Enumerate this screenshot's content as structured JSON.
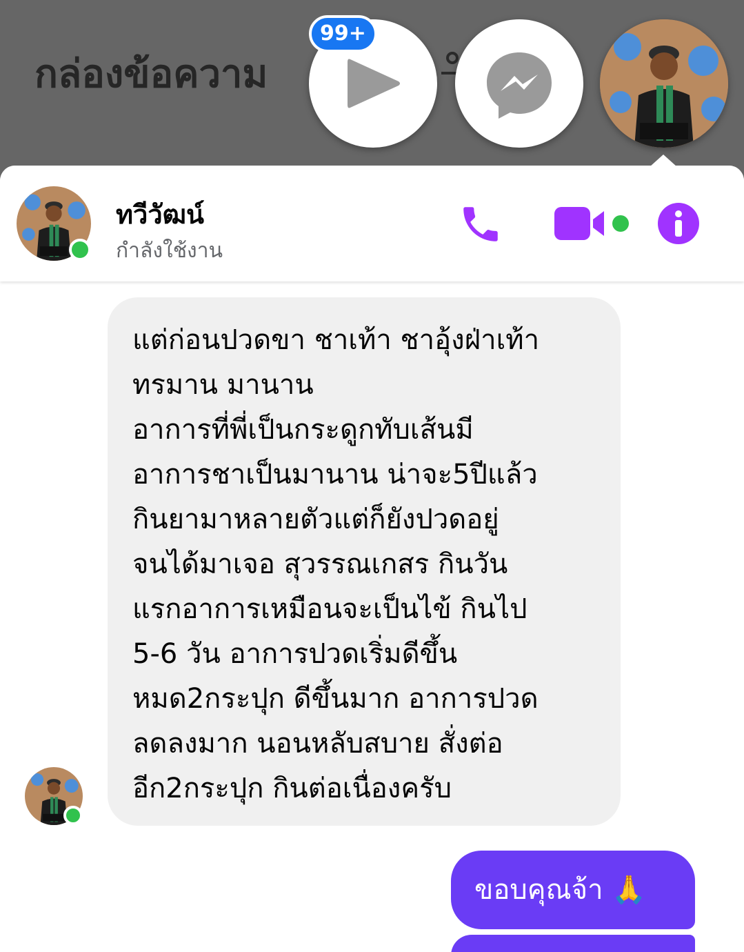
{
  "background": {
    "inbox_title": "กล่องข้อความ",
    "badge_count": "99+"
  },
  "conversation": {
    "contact_name": "ทวีวัฒน์",
    "status": "กำลังใช้งาน",
    "accent_color": "#a033ff",
    "online_color": "#31c24d"
  },
  "messages": {
    "incoming": "แต่ก่อนปวดขา ชาเท้า ชาอุ้งฝ่าเท้า\nทรมาน มานาน\nอาการที่พี่เป็นกระดูกทับเส้นมี\nอาการชาเป็นมานาน น่าจะ5ปีแล้ว\nกินยามาหลายตัวแต่ก็ยังปวดอยู่\nจนได้มาเจอ สุวรรณเกสร กินวัน\nแรกอาการเหมือนจะเป็นไข้ กินไป\n5-6 วัน อาการปวดเริ่มดีขึ้น\nหมด2กระปุก ดีขึ้นมาก อาการปวด\nลดลงมาก นอนหลับสบาย สั่งต่อ\nอีก2กระปุก กินต่อเนื่องครับ",
    "outgoing": "ขอบคุณจ้า 🙏",
    "outgoing_color": "#6a3cf5"
  },
  "icons": {
    "call": "phone-icon",
    "video": "video-camera-icon",
    "info": "info-icon",
    "messenger": "messenger-icon",
    "video_head": "play-icon"
  }
}
